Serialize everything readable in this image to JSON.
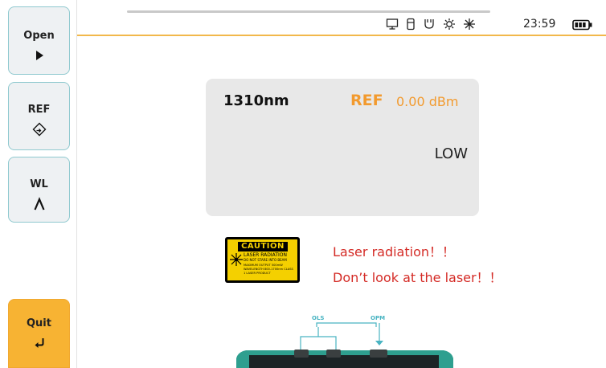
{
  "sidebar": {
    "open": {
      "label": "Open",
      "icon": "play-triangle-icon"
    },
    "ref": {
      "label": "REF",
      "icon": "diamond-arrow-icon"
    },
    "wl": {
      "label": "WL",
      "icon": "lambda-icon"
    },
    "quit": {
      "label": "Quit",
      "icon": "return-arrow-icon"
    }
  },
  "status_bar": {
    "icons": [
      "monitor-icon",
      "usb-drive-icon",
      "plug-icon",
      "gear-sun-icon",
      "sun-icon"
    ],
    "time": "23:59",
    "battery_icon": "battery-full-icon"
  },
  "measurement": {
    "wavelength": "1310nm",
    "ref_label": "REF",
    "ref_value": "0.00 dBm",
    "level": "LOW"
  },
  "caution_label": {
    "title": "CAUTION",
    "line1": "LASER RADIATION",
    "line2": "DO NOT STARE INTO BEAM",
    "line3": "MAXIMUM OUTPUT 500mW WAVELENGTH 800-1700nm CLASS 1 LASER PRODUCT"
  },
  "warnings": {
    "line1": "Laser radiation！！",
    "line2": "Don’t look at the laser！！"
  },
  "device_diagram": {
    "ols_label": "OLS",
    "opm_label": "OPM"
  },
  "colors": {
    "accent_orange": "#f29a2e",
    "quit_button": "#f7b333",
    "teal_border": "#8fc9cf",
    "warning_red": "#d42b26",
    "panel_bg": "#e8e8e8"
  }
}
